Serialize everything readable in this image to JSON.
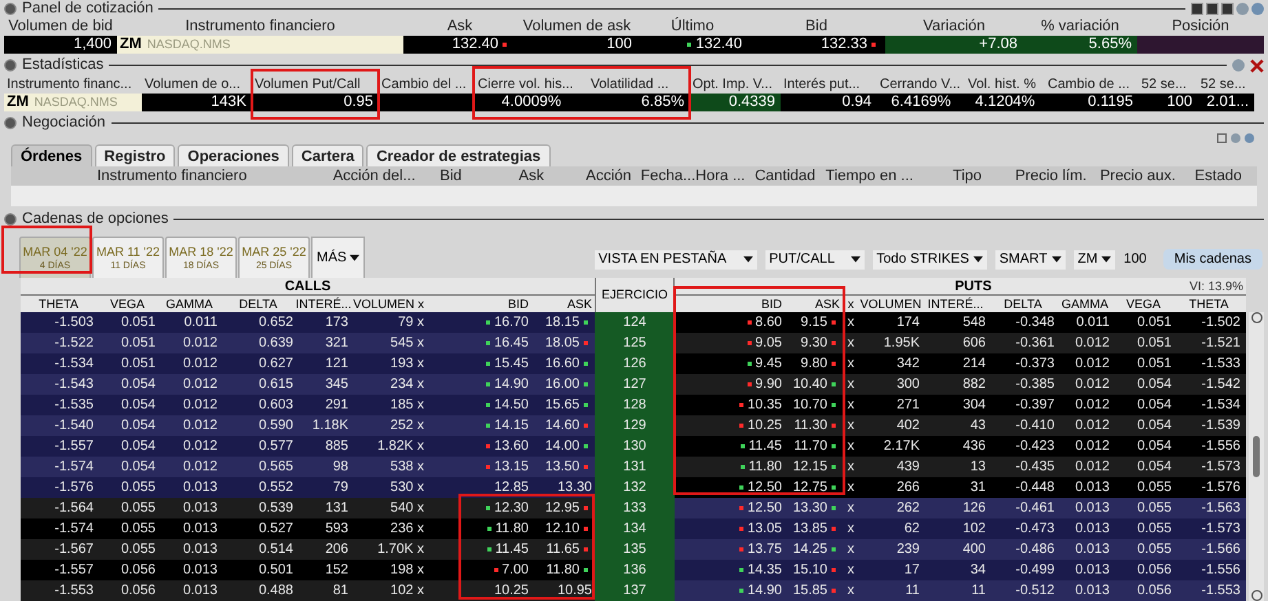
{
  "quote_panel": {
    "title": "Panel de cotización",
    "columns": [
      {
        "header": "Volumen de bid",
        "value": "1,400",
        "kind": "value"
      },
      {
        "header": "Instrumento financiero",
        "symbol": "ZM",
        "exchange": "NASDAQ.NMS",
        "kind": "instrument"
      },
      {
        "header": "Ask",
        "value": "132.40",
        "tick_up": false,
        "kind": "value"
      },
      {
        "header": "Volumen de ask",
        "value": "100",
        "kind": "value"
      },
      {
        "header": "Último",
        "value": "132.40",
        "tick_up": true,
        "kind": "value"
      },
      {
        "header": "Bid",
        "value": "132.33",
        "tick_up": false,
        "kind": "value"
      },
      {
        "header": "Variación",
        "value": "+7.08",
        "kind": "positive"
      },
      {
        "header": "% variación",
        "value": "5.65%",
        "kind": "positive"
      },
      {
        "header": "Posición",
        "kind": "position"
      }
    ]
  },
  "statistics": {
    "title": "Estadísticas",
    "columns": [
      {
        "header": "Instrumento financ...",
        "symbol": "ZM",
        "exchange": "NASDAQ.NMS",
        "kind": "instrument"
      },
      {
        "header": "Volumen de o...",
        "value": "143K",
        "kind": "value"
      },
      {
        "header": "Volumen Put/Call",
        "value": "0.95",
        "kind": "value"
      },
      {
        "header": "Cambio del ...",
        "kind": "value"
      },
      {
        "header": "Cierre vol. his...",
        "value": "4.0009%",
        "kind": "center"
      },
      {
        "header": "Volatilidad ...",
        "value": "6.85%",
        "kind": "value"
      },
      {
        "header": "Opt. Imp. V...",
        "value": "0.4339",
        "kind": "positive"
      },
      {
        "header": "Interés put...",
        "value": "0.94",
        "kind": "value"
      },
      {
        "header": "Cerrando V...",
        "value": "6.4169%",
        "kind": "center"
      },
      {
        "header": "Vol. hist. %",
        "value": "4.1204%",
        "kind": "center"
      },
      {
        "header": "Cambio de ...",
        "value": "0.1195",
        "kind": "value"
      },
      {
        "header": "52 se...",
        "value": "100",
        "kind": "value"
      },
      {
        "header": "52 se...",
        "value": "2.01...",
        "kind": "value"
      }
    ]
  },
  "trading": {
    "title": "Negociación",
    "tabs": [
      {
        "label": "Órdenes",
        "selected": true
      },
      {
        "label": "Registro",
        "selected": false
      },
      {
        "label": "Operaciones",
        "selected": false
      },
      {
        "label": "Cartera",
        "selected": false
      },
      {
        "label": "Creador de estrategias",
        "selected": false
      }
    ],
    "columns": [
      "Instrumento financiero",
      "Acción del...",
      "Bid",
      "Ask",
      "Acción",
      "Fecha...",
      "Hora ...",
      "Cantidad",
      "Tiempo en ...",
      "Tipo",
      "Precio lím.",
      "Precio aux.",
      "Estado"
    ]
  },
  "option_chains": {
    "title": "Cadenas de opciones",
    "expiries": [
      {
        "date": "MAR 04 '22",
        "days": "4 DÍAS",
        "selected": true
      },
      {
        "date": "MAR 11 '22",
        "days": "11 DÍAS",
        "selected": false
      },
      {
        "date": "MAR 18 '22",
        "days": "18 DÍAS",
        "selected": false
      },
      {
        "date": "MAR 25 '22",
        "days": "25 DÍAS",
        "selected": false
      }
    ],
    "more_label": "MÁS",
    "selects": [
      "VISTA EN PESTAÑA",
      "PUT/CALL",
      "Todo STRIKES",
      "SMART",
      "ZM"
    ],
    "multiplier": "100",
    "chains_button": "Mis cadenas",
    "implied_vol": "VI: 13.9%",
    "calls_title": "CALLS",
    "puts_title": "PUTS",
    "strike_header": "EJERCICIO",
    "call_columns": [
      "THETA",
      "VEGA",
      "GAMMA",
      "DELTA",
      "INTERÉ...",
      "VOLUMEN x",
      "BID",
      "ASK"
    ],
    "put_columns": [
      "BID",
      "ASK",
      "x",
      "VOLUMEN",
      "INTERÉ...",
      "DELTA",
      "GAMMA",
      "VEGA",
      "THETA"
    ],
    "rows": [
      {
        "strike": "124",
        "call": {
          "itm": true,
          "theta": "-1.503",
          "vega": "0.051",
          "gamma": "0.011",
          "delta": "0.652",
          "interest": "173",
          "volume": "79 x",
          "bid": "16.70",
          "ask": "18.15",
          "bid_up": true,
          "ask_up": true
        },
        "put": {
          "itm": false,
          "bid": "8.60",
          "ask": "9.15",
          "bid_up": false,
          "ask_up": false,
          "x": "x",
          "volume": "174",
          "interest": "548",
          "delta": "-0.348",
          "gamma": "0.011",
          "vega": "0.051",
          "theta": "-1.502"
        }
      },
      {
        "strike": "125",
        "call": {
          "itm": true,
          "theta": "-1.522",
          "vega": "0.051",
          "gamma": "0.012",
          "delta": "0.639",
          "interest": "321",
          "volume": "545 x",
          "bid": "16.45",
          "ask": "18.05",
          "bid_up": true,
          "ask_up": false
        },
        "put": {
          "itm": false,
          "bid": "9.05",
          "ask": "9.30",
          "bid_up": false,
          "ask_up": false,
          "x": "x",
          "volume": "1.95K",
          "interest": "606",
          "delta": "-0.361",
          "gamma": "0.012",
          "vega": "0.051",
          "theta": "-1.521"
        }
      },
      {
        "strike": "126",
        "call": {
          "itm": true,
          "theta": "-1.534",
          "vega": "0.051",
          "gamma": "0.012",
          "delta": "0.627",
          "interest": "121",
          "volume": "193 x",
          "bid": "15.45",
          "ask": "16.60",
          "bid_up": true,
          "ask_up": true
        },
        "put": {
          "itm": false,
          "bid": "9.45",
          "ask": "9.80",
          "bid_up": true,
          "ask_up": false,
          "x": "x",
          "volume": "342",
          "interest": "214",
          "delta": "-0.373",
          "gamma": "0.012",
          "vega": "0.051",
          "theta": "-1.533"
        }
      },
      {
        "strike": "127",
        "call": {
          "itm": true,
          "theta": "-1.543",
          "vega": "0.054",
          "gamma": "0.012",
          "delta": "0.615",
          "interest": "345",
          "volume": "234 x",
          "bid": "14.90",
          "ask": "16.00",
          "bid_up": true,
          "ask_up": true
        },
        "put": {
          "itm": false,
          "bid": "9.90",
          "ask": "10.40",
          "bid_up": false,
          "ask_up": true,
          "x": "x",
          "volume": "300",
          "interest": "882",
          "delta": "-0.385",
          "gamma": "0.012",
          "vega": "0.054",
          "theta": "-1.542"
        }
      },
      {
        "strike": "128",
        "call": {
          "itm": true,
          "theta": "-1.535",
          "vega": "0.054",
          "gamma": "0.012",
          "delta": "0.603",
          "interest": "291",
          "volume": "185 x",
          "bid": "14.50",
          "ask": "15.65",
          "bid_up": true,
          "ask_up": true
        },
        "put": {
          "itm": false,
          "bid": "10.35",
          "ask": "10.70",
          "bid_up": false,
          "ask_up": true,
          "x": "x",
          "volume": "271",
          "interest": "304",
          "delta": "-0.397",
          "gamma": "0.012",
          "vega": "0.054",
          "theta": "-1.534"
        }
      },
      {
        "strike": "129",
        "call": {
          "itm": true,
          "theta": "-1.540",
          "vega": "0.054",
          "gamma": "0.012",
          "delta": "0.590",
          "interest": "1.18K",
          "volume": "252 x",
          "bid": "14.15",
          "ask": "14.60",
          "bid_up": true,
          "ask_up": false
        },
        "put": {
          "itm": false,
          "bid": "10.25",
          "ask": "11.30",
          "bid_up": false,
          "ask_up": false,
          "x": "x",
          "volume": "402",
          "interest": "43",
          "delta": "-0.410",
          "gamma": "0.012",
          "vega": "0.054",
          "theta": "-1.539"
        }
      },
      {
        "strike": "130",
        "call": {
          "itm": true,
          "theta": "-1.557",
          "vega": "0.054",
          "gamma": "0.012",
          "delta": "0.577",
          "interest": "885",
          "volume": "1.82K x",
          "bid": "13.60",
          "ask": "14.00",
          "bid_up": false,
          "ask_up": true
        },
        "put": {
          "itm": false,
          "bid": "11.45",
          "ask": "11.70",
          "bid_up": true,
          "ask_up": true,
          "x": "x",
          "volume": "2.17K",
          "interest": "436",
          "delta": "-0.423",
          "gamma": "0.012",
          "vega": "0.054",
          "theta": "-1.556"
        }
      },
      {
        "strike": "131",
        "call": {
          "itm": true,
          "theta": "-1.574",
          "vega": "0.054",
          "gamma": "0.012",
          "delta": "0.565",
          "interest": "98",
          "volume": "538 x",
          "bid": "13.15",
          "ask": "13.50",
          "bid_up": false,
          "ask_up": false
        },
        "put": {
          "itm": false,
          "bid": "11.80",
          "ask": "12.15",
          "bid_up": true,
          "ask_up": true,
          "x": "x",
          "volume": "439",
          "interest": "13",
          "delta": "-0.435",
          "gamma": "0.012",
          "vega": "0.054",
          "theta": "-1.573"
        }
      },
      {
        "strike": "132",
        "call": {
          "itm": true,
          "theta": "-1.576",
          "vega": "0.055",
          "gamma": "0.013",
          "delta": "0.552",
          "interest": "79",
          "volume": "530 x",
          "bid": "12.85",
          "ask": "13.30"
        },
        "put": {
          "itm": false,
          "bid": "12.50",
          "ask": "12.75",
          "bid_up": true,
          "ask_up": true,
          "x": "x",
          "volume": "266",
          "interest": "31",
          "delta": "-0.448",
          "gamma": "0.013",
          "vega": "0.055",
          "theta": "-1.576"
        }
      },
      {
        "strike": "133",
        "call": {
          "itm": false,
          "theta": "-1.564",
          "vega": "0.055",
          "gamma": "0.013",
          "delta": "0.539",
          "interest": "131",
          "volume": "540 x",
          "bid": "12.30",
          "ask": "12.95",
          "bid_up": true,
          "ask_up": false
        },
        "put": {
          "itm": true,
          "bid": "12.50",
          "ask": "13.30",
          "bid_up": false,
          "ask_up": true,
          "x": "x",
          "volume": "262",
          "interest": "126",
          "delta": "-0.461",
          "gamma": "0.013",
          "vega": "0.055",
          "theta": "-1.563"
        }
      },
      {
        "strike": "134",
        "call": {
          "itm": false,
          "theta": "-1.574",
          "vega": "0.055",
          "gamma": "0.013",
          "delta": "0.527",
          "interest": "593",
          "volume": "236 x",
          "bid": "11.80",
          "ask": "12.10",
          "bid_up": true,
          "ask_up": false
        },
        "put": {
          "itm": true,
          "bid": "13.05",
          "ask": "13.85",
          "bid_up": false,
          "ask_up": false,
          "x": "x",
          "volume": "62",
          "interest": "102",
          "delta": "-0.473",
          "gamma": "0.013",
          "vega": "0.055",
          "theta": "-1.573"
        }
      },
      {
        "strike": "135",
        "call": {
          "itm": false,
          "theta": "-1.567",
          "vega": "0.055",
          "gamma": "0.013",
          "delta": "0.514",
          "interest": "206",
          "volume": "1.70K x",
          "bid": "11.45",
          "ask": "11.65",
          "bid_up": true,
          "ask_up": false
        },
        "put": {
          "itm": true,
          "bid": "13.75",
          "ask": "14.25",
          "bid_up": false,
          "ask_up": true,
          "x": "x",
          "volume": "239",
          "interest": "400",
          "delta": "-0.486",
          "gamma": "0.013",
          "vega": "0.055",
          "theta": "-1.566"
        }
      },
      {
        "strike": "136",
        "call": {
          "itm": false,
          "theta": "-1.557",
          "vega": "0.056",
          "gamma": "0.013",
          "delta": "0.501",
          "interest": "152",
          "volume": "198 x",
          "bid": "7.00",
          "ask": "11.80",
          "bid_up": false,
          "ask_up": true
        },
        "put": {
          "itm": true,
          "bid": "14.35",
          "ask": "15.10",
          "bid_up": true,
          "ask_up": false,
          "x": "x",
          "volume": "17",
          "interest": "34",
          "delta": "-0.499",
          "gamma": "0.013",
          "vega": "0.056",
          "theta": "-1.556"
        }
      },
      {
        "strike": "137",
        "call": {
          "itm": false,
          "theta": "-1.553",
          "vega": "0.056",
          "gamma": "0.013",
          "delta": "0.488",
          "interest": "81",
          "volume": "102 x",
          "bid": "10.25",
          "ask": "10.95"
        },
        "put": {
          "itm": true,
          "bid": "14.90",
          "ask": "15.85",
          "bid_up": true,
          "ask_up": false,
          "x": "x",
          "volume": "11",
          "interest": "11",
          "delta": "-0.512",
          "gamma": "0.013",
          "vega": "0.056",
          "theta": "-1.553"
        }
      }
    ]
  }
}
